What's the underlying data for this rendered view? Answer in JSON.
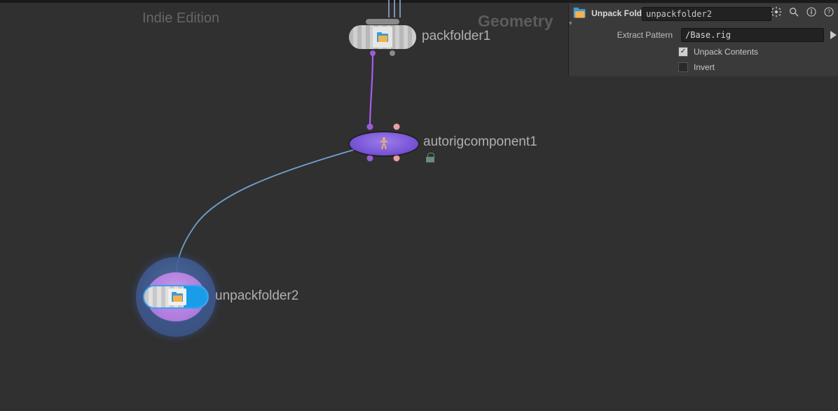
{
  "watermark": {
    "edition": "Indie Edition",
    "context": "Geometry"
  },
  "nodes": {
    "packfolder1": {
      "label": "packfolder1"
    },
    "autorigcomponent1": {
      "label": "autorigcomponent1"
    },
    "unpackfolder2": {
      "label": "unpackfolder2"
    }
  },
  "panel": {
    "node_type": "Unpack Folder",
    "node_name": "unpackfolder2",
    "params": {
      "extract_pattern": {
        "label": "Extract Pattern",
        "value": "/Base.rig"
      },
      "unpack_contents": {
        "label": "Unpack Contents",
        "checked": true
      },
      "invert": {
        "label": "Invert",
        "checked": false
      }
    }
  }
}
